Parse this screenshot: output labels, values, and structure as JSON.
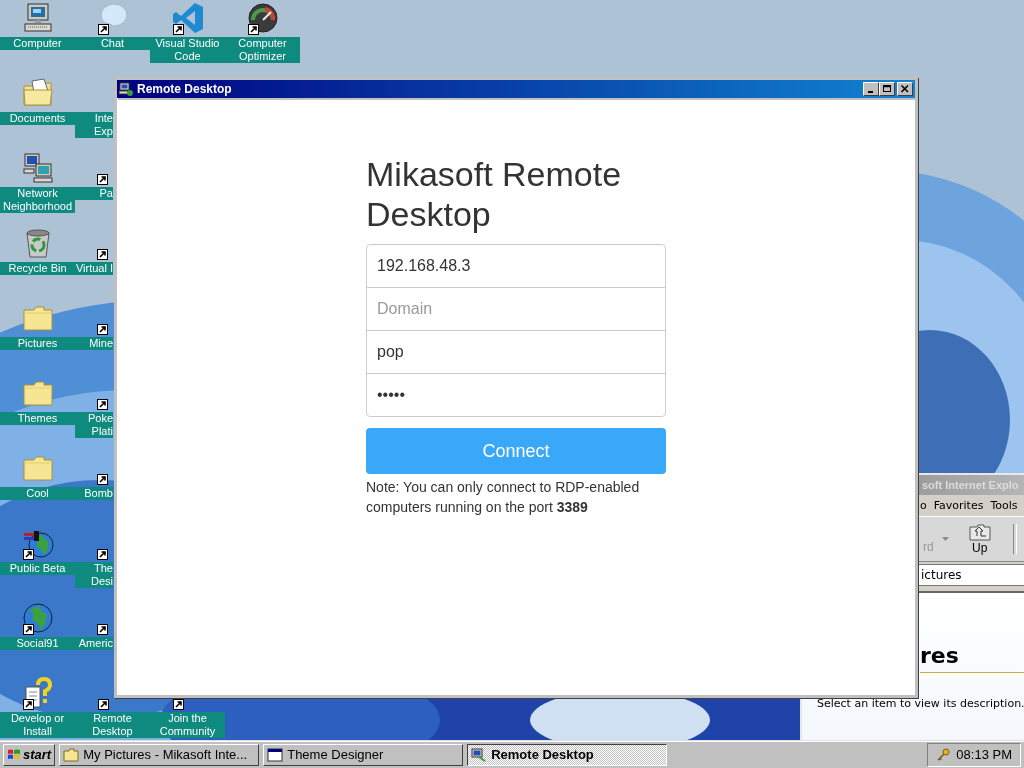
{
  "desktop": {
    "wallpaper": {
      "kind": "picture"
    },
    "icon_rows": [
      [
        {
          "label": "Computer",
          "kind": "computer",
          "shortcut": false,
          "partial": false
        },
        {
          "label": "Chat",
          "kind": "bubble",
          "shortcut": true,
          "partial": false
        },
        {
          "label": "Visual Studio Code",
          "kind": "ribbon",
          "shortcut": true,
          "partial": false
        },
        {
          "label": "Computer Optimizer",
          "kind": "gauge",
          "shortcut": true,
          "partial": false
        }
      ],
      [
        {
          "label": "Documents",
          "kind": "docs",
          "shortcut": false,
          "partial": false
        },
        {
          "label": "Inte Exp",
          "kind": "hidden",
          "shortcut": false,
          "partial": true
        }
      ],
      [
        {
          "label": "Network Neighborhood",
          "kind": "network",
          "shortcut": false,
          "partial": false
        },
        {
          "label": "Pa",
          "kind": "hidden",
          "shortcut": true,
          "partial": true
        }
      ],
      [
        {
          "label": "Recycle Bin",
          "kind": "recycle",
          "shortcut": false,
          "partial": false
        },
        {
          "label": "Virtual I",
          "kind": "hidden",
          "shortcut": true,
          "partial": true
        }
      ],
      [
        {
          "label": "Pictures",
          "kind": "folder",
          "shortcut": false,
          "partial": false
        },
        {
          "label": "Mine",
          "kind": "hidden",
          "shortcut": true,
          "partial": true
        }
      ],
      [
        {
          "label": "Themes",
          "kind": "folder",
          "shortcut": false,
          "partial": false
        },
        {
          "label": "Poke Plati",
          "kind": "hidden",
          "shortcut": true,
          "partial": true
        }
      ],
      [
        {
          "label": "Cool",
          "kind": "folder",
          "shortcut": false,
          "partial": false
        },
        {
          "label": "Bomb",
          "kind": "hidden",
          "shortcut": true,
          "partial": true
        }
      ],
      [
        {
          "label": "Public Beta",
          "kind": "beta",
          "shortcut": true,
          "partial": false
        },
        {
          "label": "The Desi",
          "kind": "hidden",
          "shortcut": true,
          "partial": true
        }
      ],
      [
        {
          "label": "Social91",
          "kind": "globe",
          "shortcut": true,
          "partial": false
        },
        {
          "label": "Americ",
          "kind": "hidden",
          "shortcut": true,
          "partial": true
        }
      ],
      [
        {
          "label": "Develop or Install",
          "kind": "help",
          "shortcut": true,
          "partial": false
        },
        {
          "label": "Remote Desktop",
          "kind": "hidden",
          "shortcut": true,
          "partial": false
        },
        {
          "label": "Join the Community",
          "kind": "hidden",
          "shortcut": true,
          "partial": false
        }
      ]
    ]
  },
  "browser_window": {
    "title": "soft Internet Explo",
    "menu": [
      "o",
      "Favorites",
      "Tools"
    ],
    "toolbar": [
      {
        "label": "rd",
        "kind": "text",
        "disabled": true
      },
      {
        "label": "Up",
        "kind": "up",
        "disabled": false
      }
    ],
    "address": "ictures",
    "heading": "res",
    "description": "Select an item to view its description."
  },
  "remote_window": {
    "title": "Remote Desktop",
    "heading": "Mikasoft Remote Desktop",
    "fields": [
      {
        "value": "192.168.48.3"
      },
      {
        "placeholder": "Domain"
      },
      {
        "value": "pop"
      },
      {
        "value": "•••••"
      }
    ],
    "button": "Connect",
    "note": "Note: You can only connect to RDP-enabled computers running on the port **3389**"
  },
  "taskbar": {
    "start": "start",
    "tasks": [
      {
        "label": "My Pictures - Mikasoft Inte...",
        "kind": "folder",
        "selected": false
      },
      {
        "label": "Theme Designer",
        "kind": "window",
        "selected": false
      },
      {
        "label": "Remote Desktop",
        "kind": "remote",
        "selected": true
      }
    ],
    "clock": "08:13 PM"
  }
}
